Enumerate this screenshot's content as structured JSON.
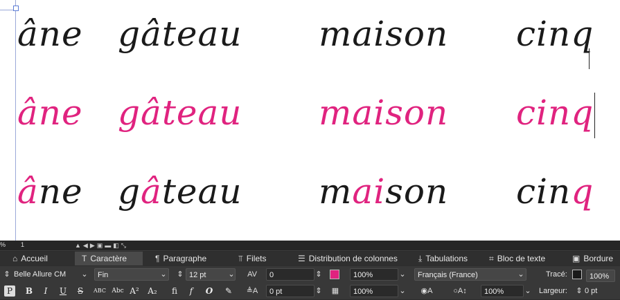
{
  "canvas": {
    "row1": [
      "âne",
      "gâteau",
      "maison",
      "cinq"
    ],
    "row2": [
      "âne",
      "gâteau",
      "maison",
      "cinq"
    ],
    "row3": [
      {
        "pre": "",
        "hl": "â",
        "post": "ne"
      },
      {
        "pre": "g",
        "hl": "â",
        "post": "teau"
      },
      {
        "pre": "m",
        "hl": "ai",
        "post": "son"
      },
      {
        "pre": "cin",
        "hl": "q",
        "post": ""
      }
    ],
    "colors": {
      "ink": "#1a1a1a",
      "accent": "#e0237f"
    }
  },
  "statusbar": {
    "zoom": "%",
    "page": "1"
  },
  "tabs": [
    {
      "label": "Accueil",
      "icon": "home-icon",
      "glyph": "⌂"
    },
    {
      "label": "Caractère",
      "icon": "type-tool-icon",
      "glyph": "T"
    },
    {
      "label": "Paragraphe",
      "icon": "pilcrow-icon",
      "glyph": "¶"
    },
    {
      "label": "Filets",
      "icon": "rule-icon",
      "glyph": "⫪"
    },
    {
      "label": "Distribution de colonnes",
      "icon": "columns-icon",
      "glyph": "☰"
    },
    {
      "label": "Tabulations",
      "icon": "tab-stop-icon",
      "glyph": "⤓"
    },
    {
      "label": "Bloc de texte",
      "icon": "text-frame-icon",
      "glyph": "⌗"
    },
    {
      "label": "Bordure",
      "icon": "border-icon",
      "glyph": "▣"
    }
  ],
  "controls": {
    "font_family": "Belle Allure CM",
    "font_style": "Fin",
    "font_size": "12 pt",
    "kerning": "0",
    "fill_scale": "100%",
    "language": "Français (France)",
    "stroke_label": "Tracé:",
    "stroke_value": "100%",
    "baseline_shift": "0 pt",
    "scale_h": "100%",
    "scale_v": "100%",
    "width_label": "Largeur:",
    "width_value": "0 pt",
    "fill_color": "#e0237f"
  },
  "styles_buttons": [
    "P",
    "B",
    "I",
    "U",
    "S",
    "ABC",
    "Abc",
    "A²",
    "A₂",
    "fi",
    "𝑓",
    "O",
    "✎"
  ]
}
